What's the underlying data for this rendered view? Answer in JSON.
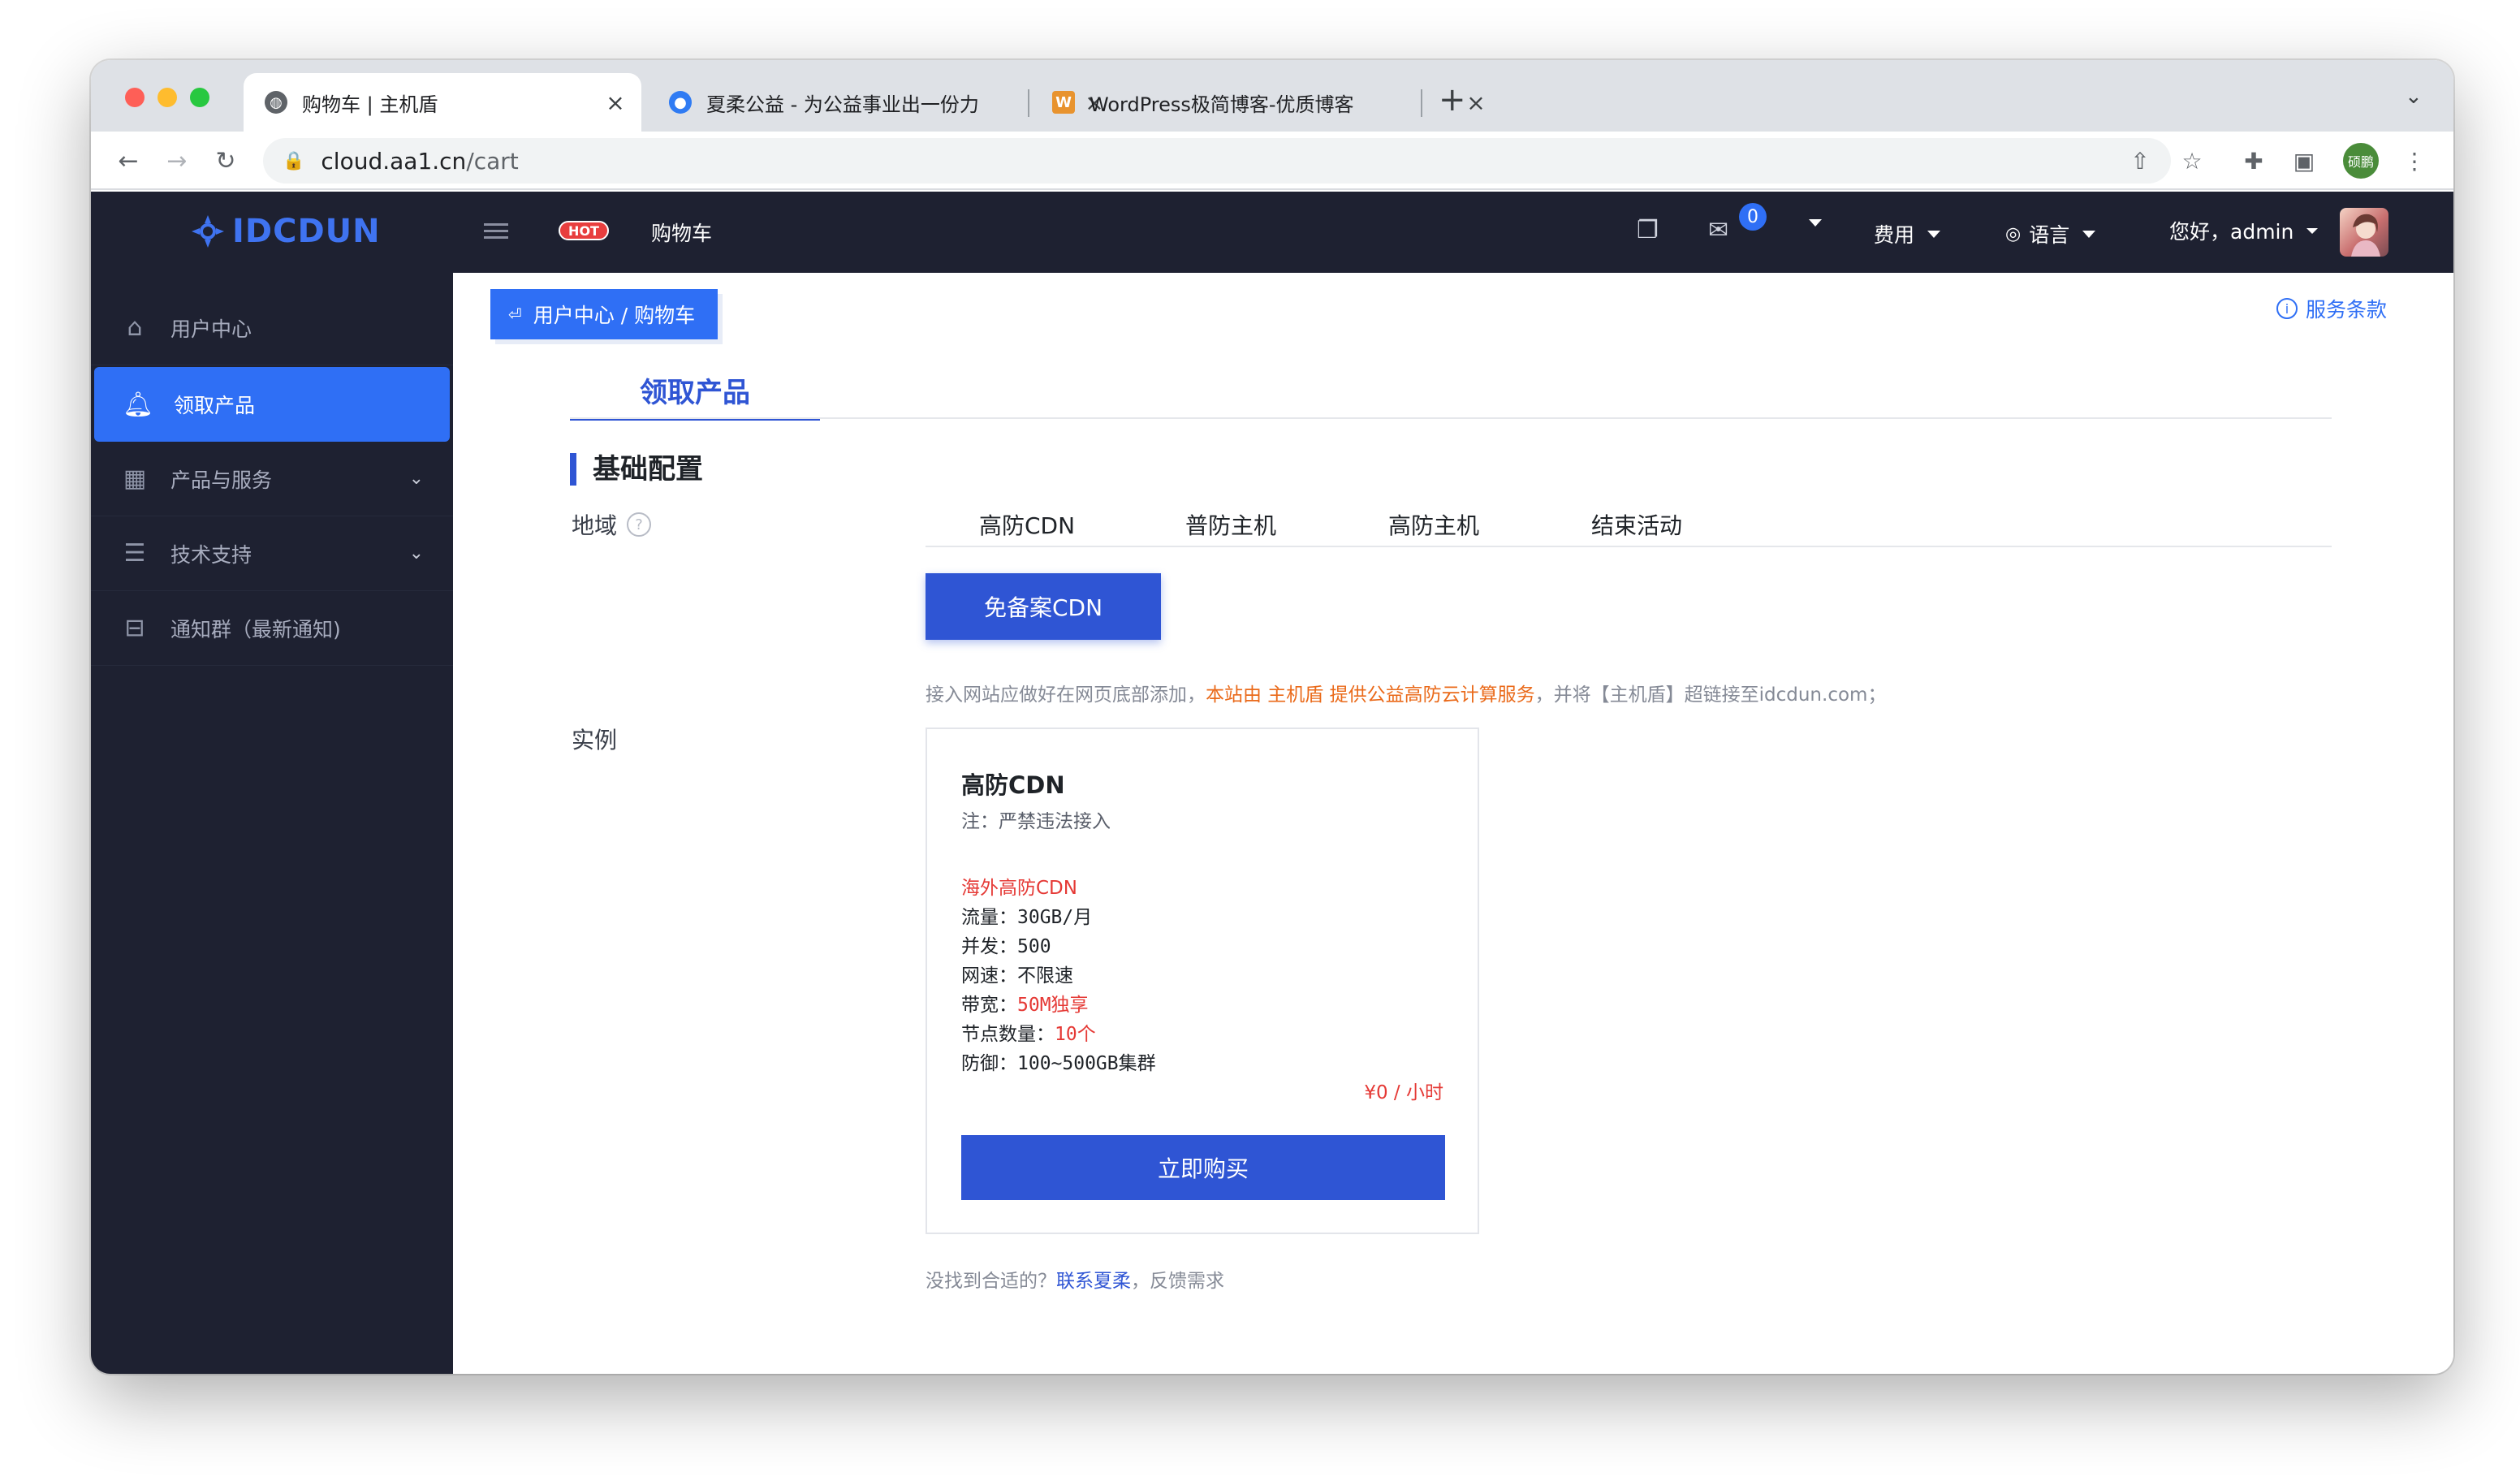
{
  "browser": {
    "tabs": [
      {
        "title": "购物车 | 主机盾",
        "close": "×"
      },
      {
        "title": "夏柔公益 - 为公益事业出一份力",
        "close": "×"
      },
      {
        "title": "WordPress极简博客-优质博客",
        "close": "×"
      }
    ],
    "new_tab": "+",
    "url_domain": "cloud.aa1.cn",
    "url_path": "/cart",
    "profile_label": "硕鹏",
    "favicon_w": "W"
  },
  "topbar": {
    "logo": "IDCDUN",
    "hot_badge": "HOT",
    "cart_label": "购物车",
    "message_count": "0",
    "fee_label": "费用",
    "lang_label": "语言",
    "greeting": "您好，admin"
  },
  "sidebar": {
    "items": [
      {
        "label": "用户中心",
        "icon": "home-icon"
      },
      {
        "label": "领取产品",
        "icon": "bell-icon"
      },
      {
        "label": "产品与服务",
        "icon": "grid-icon"
      },
      {
        "label": "技术支持",
        "icon": "document-icon"
      },
      {
        "label": "通知群（最新通知)",
        "icon": "bus-icon"
      }
    ]
  },
  "main": {
    "breadcrumb": "用户中心 / 购物车",
    "terms_link": "服务条款",
    "page_tab": "领取产品",
    "section_title": "基础配置",
    "region_label": "地域",
    "regions": [
      "高防CDN",
      "普防主机",
      "高防主机",
      "结束活动"
    ],
    "selected_product_button": "免备案CDN",
    "note_prefix": "接入网站应做好在网页底部添加，",
    "note_highlight": "本站由 主机盾 提供公益高防云计算服务",
    "note_suffix": "，并将【主机盾】超链接至idcdun.com；",
    "instance_label": "实例",
    "card": {
      "title": "高防CDN",
      "subtitle": "注：严禁违法接入",
      "tagline": "海外高防CDN",
      "traffic": "流量：30GB/月",
      "concurrency": "并发：500",
      "speed": "网速：不限速",
      "bandwidth_key": "带宽：",
      "bandwidth_val": "50M独享",
      "nodes_key": "节点数量：",
      "nodes_val": "10个",
      "defense": "防御：100~500GB集群",
      "price": "¥0 / 小时",
      "buy_button": "立即购买"
    },
    "footer_prefix": "没找到合适的？",
    "footer_link": "联系夏柔",
    "footer_suffix": "，反馈需求"
  },
  "colors": {
    "accent": "#2f55d4",
    "sidebar_bg": "#1e2131",
    "active_blue": "#2f6ff5",
    "highlight_orange": "#ea6a1a",
    "price_red": "#e53935"
  }
}
